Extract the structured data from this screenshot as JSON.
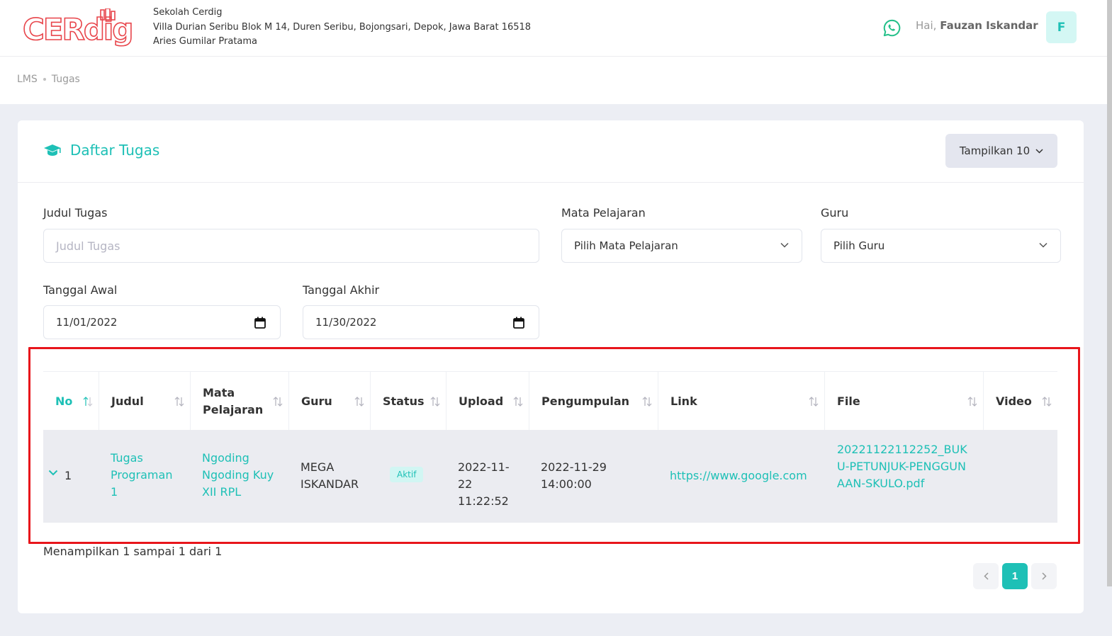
{
  "header": {
    "logo_text": "CERdig",
    "school_name": "Sekolah Cerdig",
    "address": "Villa Durian Seribu Blok M 14, Duren Seribu, Bojongsari, Depok, Jawa Barat 16518",
    "principal": "Aries Gumilar Pratama",
    "greeting": "Hai,",
    "user_name": "Fauzan Iskandar",
    "avatar_initial": "F",
    "whatsapp_icon": "whatsapp-icon"
  },
  "breadcrumb": [
    "LMS",
    "Tugas"
  ],
  "card": {
    "title": "Daftar Tugas",
    "title_icon": "graduation-cap-icon",
    "show_button": "Tampilkan 10"
  },
  "filters": {
    "judul_label": "Judul Tugas",
    "judul_placeholder": "Judul Tugas",
    "mapel_label": "Mata Pelajaran",
    "mapel_value": "Pilih Mata Pelajaran",
    "guru_label": "Guru",
    "guru_value": "Pilih Guru",
    "awal_label": "Tanggal Awal",
    "awal_value": "11/01/2022",
    "akhir_label": "Tanggal Akhir",
    "akhir_value": "11/30/2022"
  },
  "table": {
    "columns": [
      "No",
      "Judul",
      "Mata Pelajaran",
      "Guru",
      "Status",
      "Upload",
      "Pengumpulan",
      "Link",
      "File",
      "Video"
    ],
    "rows": [
      {
        "no": "1",
        "judul": "Tugas Programan 1",
        "mapel": "Ngoding Ngoding Kuy XII RPL",
        "guru": "MEGA ISKANDAR",
        "status": "Aktif",
        "upload": "2022-11-22 11:22:52",
        "pengumpulan": "2022-11-29 14:00:00",
        "link": "https://www.google.com",
        "file": "20221122112252_BUKU-PETUNJUK-PENGGUNAAN-SKULO.pdf",
        "video": ""
      }
    ]
  },
  "footer": {
    "info": "Menampilkan 1 sampai 1 dari 1",
    "current_page": "1"
  },
  "colors": {
    "accent": "#1ec0b6",
    "highlight": "#e8151b",
    "row_bg": "#ebecf1"
  }
}
